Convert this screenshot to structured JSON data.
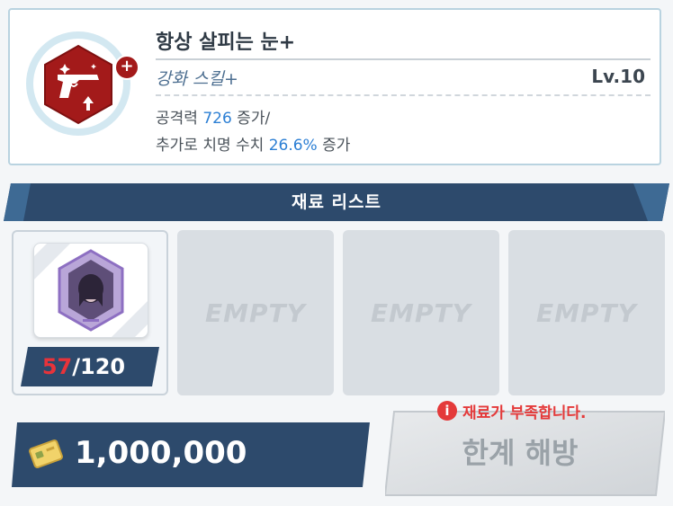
{
  "skill": {
    "name": "항상 살피는 눈+",
    "type": "강화 스킬+",
    "level": "Lv.10",
    "icon": "pistol-icon",
    "desc_line1": {
      "prefix": "공격력 ",
      "value": "726",
      "suffix": " 증가/"
    },
    "desc_line2": {
      "prefix": "추가로 치명 수치 ",
      "value": "26.6%",
      "suffix": " 증가"
    }
  },
  "materials": {
    "title": "재료 리스트",
    "slot1": {
      "icon": "character-crystal-icon",
      "current": "57",
      "required": "/120"
    },
    "empty_label": "EMPTY"
  },
  "currency": {
    "icon": "credit-card-icon",
    "amount": "1,000,000"
  },
  "warning": {
    "icon": "info-icon",
    "symbol": "i",
    "text": "재료가 부족합니다."
  },
  "action": {
    "label": "한계 해방"
  },
  "colors": {
    "navy": "#2d4a6c",
    "accent_blue": "#2c7fd4",
    "warning_red": "#e43a3a",
    "skill_icon_red": "#a31a1a"
  }
}
